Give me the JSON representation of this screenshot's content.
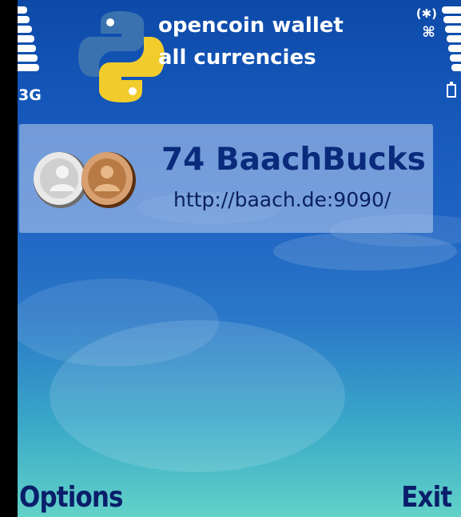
{
  "status_bar": {
    "network": "3G",
    "bluetooth_icon": "bluetooth-icon",
    "connectivity_icon": "network-connection-icon"
  },
  "app": {
    "title_line1": "opencoin wallet",
    "title_line2": "all currencies",
    "logo_icon": "python-logo-icon"
  },
  "wallet": {
    "items": [
      {
        "amount": "74 BaachBucks",
        "url": "http://baach.de:9090/",
        "icon": "coins-icon"
      }
    ]
  },
  "softkeys": {
    "left": "Options",
    "right": "Exit"
  },
  "colors": {
    "background_top": "#0d4aa8",
    "background_bottom": "#62d2c8",
    "amount_text": "#0a2a7c",
    "softkey_text": "#0a1e6a"
  }
}
